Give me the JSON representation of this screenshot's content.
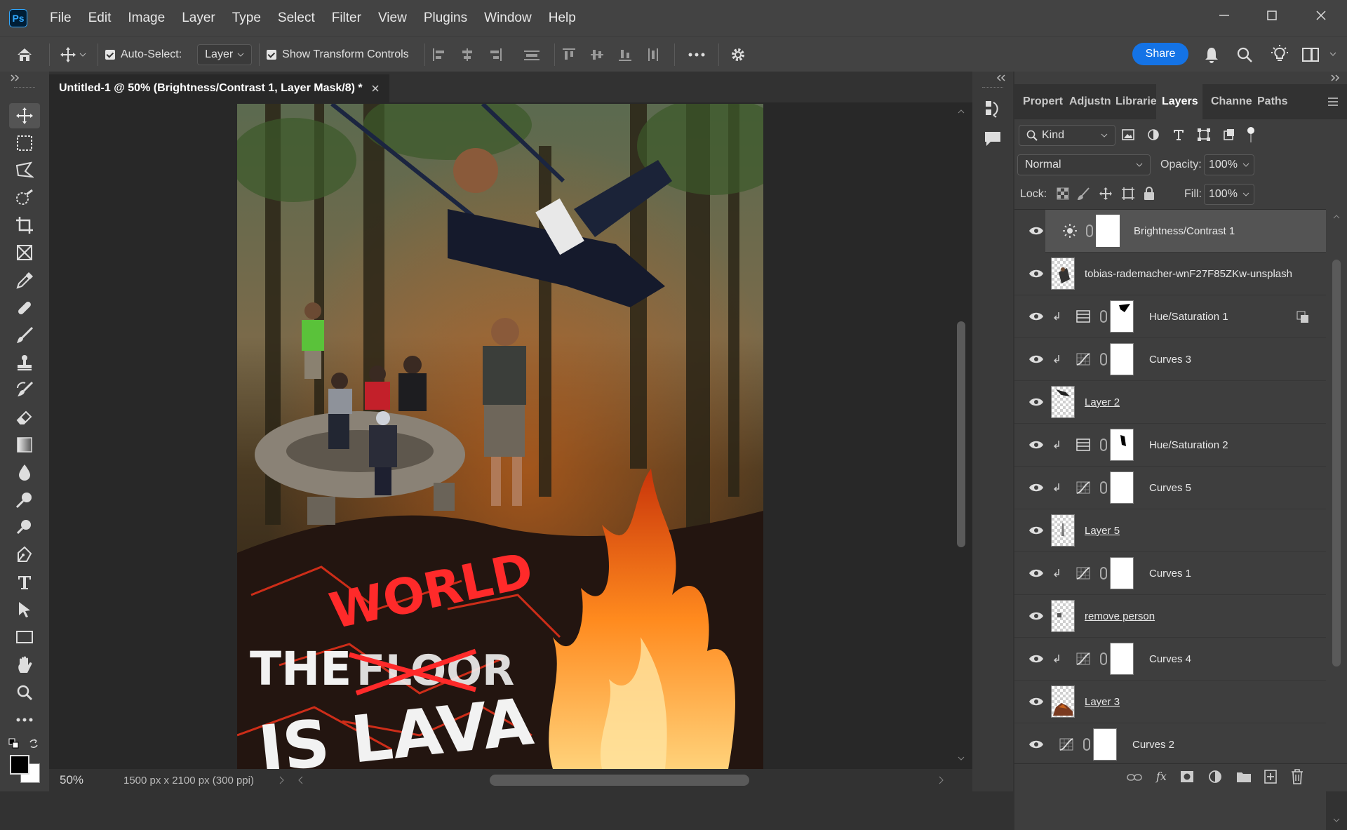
{
  "app": {
    "logo": "Ps"
  },
  "menu": [
    "File",
    "Edit",
    "Image",
    "Layer",
    "Type",
    "Select",
    "Filter",
    "View",
    "Plugins",
    "Window",
    "Help"
  ],
  "options": {
    "auto_select_label": "Auto-Select:",
    "auto_select_value": "Layer",
    "show_transform_label": "Show Transform Controls",
    "share_label": "Share"
  },
  "document": {
    "tab_title": "Untitled-1 @ 50% (Brightness/Contrast 1, Layer Mask/8) *",
    "zoom": "50%",
    "doc_info": "1500 px x 2100 px (300 ppi)",
    "artwork_text": {
      "line1a": "THE",
      "crossed": "FLOOR",
      "replacement": "WORLD",
      "line2": "IS LAVA"
    }
  },
  "panel": {
    "tabs": [
      "Propert",
      "Adjustn",
      "Librarie",
      "Layers",
      "Channe",
      "Paths"
    ],
    "active_tab": "Layers",
    "filter_kind": "Kind",
    "blend_mode": "Normal",
    "opacity_label": "Opacity:",
    "opacity_value": "100%",
    "lock_label": "Lock:",
    "fill_label": "Fill:",
    "fill_value": "100%",
    "layers": [
      {
        "name": "Brightness/Contrast 1",
        "type": "adjustment",
        "icon": "brightness-icon",
        "selected": true
      },
      {
        "name": "tobias-rademacher-wnF27F85ZKw-unsplash",
        "type": "image"
      },
      {
        "name": "Hue/Saturation 1",
        "type": "adjustment",
        "icon": "hue-sat-icon",
        "clipped": true
      },
      {
        "name": "Curves 3",
        "type": "adjustment",
        "icon": "curves-icon",
        "clipped": true
      },
      {
        "name": "Layer 2",
        "type": "pixel",
        "underline": true
      },
      {
        "name": "Hue/Saturation 2",
        "type": "adjustment",
        "icon": "hue-sat-icon",
        "clipped": true
      },
      {
        "name": "Curves 5",
        "type": "adjustment",
        "icon": "curves-icon",
        "clipped": true
      },
      {
        "name": "Layer 5",
        "type": "pixel",
        "underline": true
      },
      {
        "name": "Curves 1",
        "type": "adjustment",
        "icon": "curves-icon",
        "clipped": true
      },
      {
        "name": "remove person",
        "type": "pixel",
        "underline": true
      },
      {
        "name": "Curves 4",
        "type": "adjustment",
        "icon": "curves-icon",
        "clipped": true
      },
      {
        "name": "Layer 3",
        "type": "pixel",
        "underline": true
      },
      {
        "name": "Curves 2",
        "type": "adjustment",
        "icon": "curves-icon"
      }
    ]
  }
}
